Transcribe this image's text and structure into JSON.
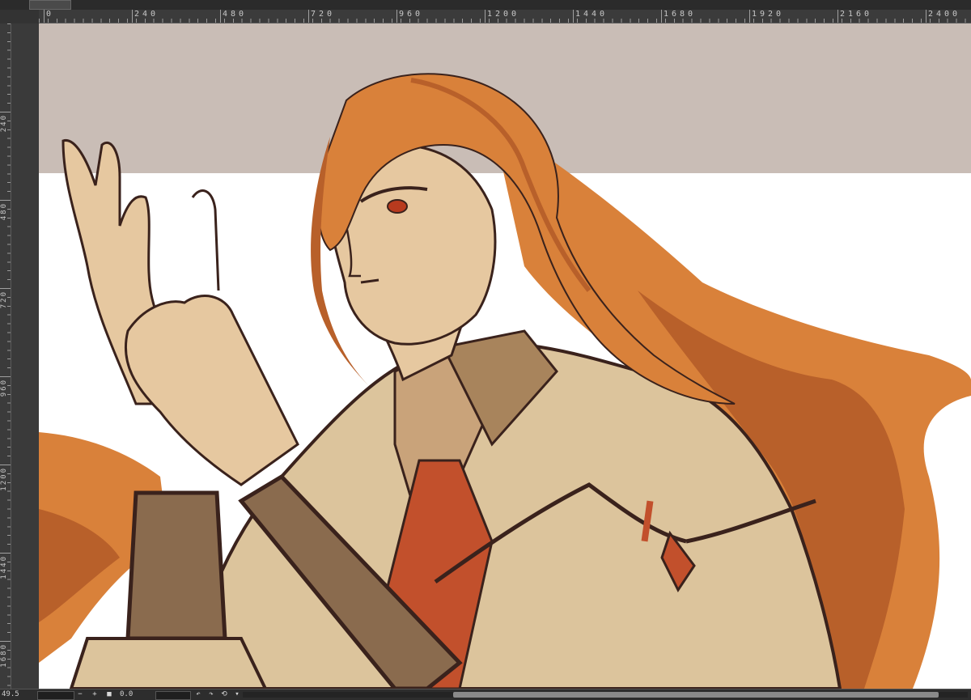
{
  "ruler": {
    "horizontal_labels": [
      "0",
      "240",
      "480",
      "720",
      "960",
      "1200",
      "1440",
      "1680",
      "1920",
      "2160",
      "2400"
    ],
    "vertical_labels": [
      "240",
      "480",
      "720",
      "960",
      "1200",
      "1440",
      "1680"
    ]
  },
  "status": {
    "zoom_label": "49.5",
    "angle_label": "0.0",
    "zoom_out_symbol": "−",
    "zoom_in_symbol": "+",
    "fit_symbol": "■",
    "rotate_left_symbol": "↶",
    "rotate_right_symbol": "↷",
    "reset_rotation_symbol": "⟲",
    "flip_symbol": "▾"
  },
  "canvas": {
    "artwork": "character illustration",
    "palette": {
      "background_top": "#c9bdb6",
      "background_panel": "#ffffff",
      "hair": "#d9813a",
      "hair_shadow": "#b8602a",
      "skin": "#e6c8a0",
      "coat": "#dcc49c",
      "tie": "#c2502c",
      "cuff": "#8a6b4e",
      "lineart": "#3a221c"
    }
  },
  "scrollbar": {
    "visible": true
  }
}
